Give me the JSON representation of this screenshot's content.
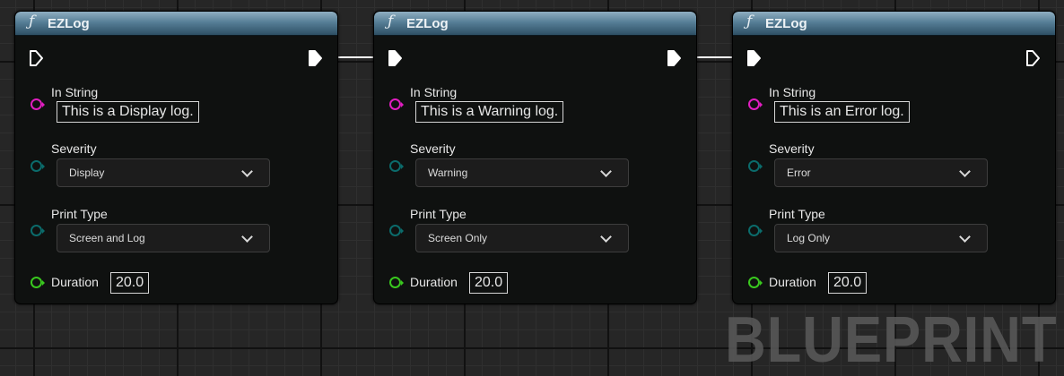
{
  "nodes": [
    {
      "title": "EZLog",
      "in_string": {
        "label": "In String",
        "value": "This is a Display log."
      },
      "severity": {
        "label": "Severity",
        "value": "Display"
      },
      "print_type": {
        "label": "Print Type",
        "value": "Screen and Log"
      },
      "duration": {
        "label": "Duration",
        "value": "20.0"
      }
    },
    {
      "title": "EZLog",
      "in_string": {
        "label": "In String",
        "value": "This is a Warning log."
      },
      "severity": {
        "label": "Severity",
        "value": "Warning"
      },
      "print_type": {
        "label": "Print Type",
        "value": "Screen Only"
      },
      "duration": {
        "label": "Duration",
        "value": "20.0"
      }
    },
    {
      "title": "EZLog",
      "in_string": {
        "label": "In String",
        "value": "This is an Error log."
      },
      "severity": {
        "label": "Severity",
        "value": "Error"
      },
      "print_type": {
        "label": "Print Type",
        "value": "Log Only"
      },
      "duration": {
        "label": "Duration",
        "value": "20.0"
      }
    }
  ],
  "watermark": "BLUEPRINT",
  "colors": {
    "string_pin": "#e01ec0",
    "enum_pin": "#0b6b6b",
    "float_pin": "#39c81e",
    "exec_pin": "#ffffff",
    "header": "#4d7a93"
  },
  "icons": {
    "function": "function-icon",
    "exec": "exec-pin-icon",
    "dropdown": "chevron-down-icon"
  }
}
